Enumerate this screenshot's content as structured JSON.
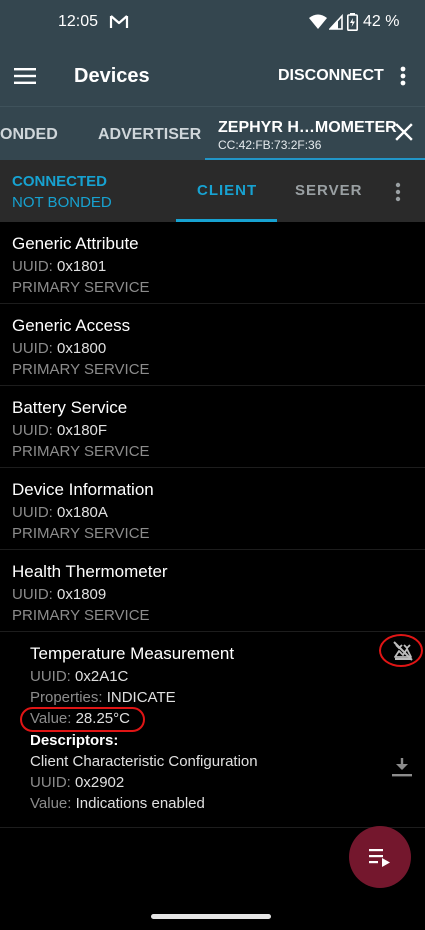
{
  "status_bar": {
    "time": "12:05",
    "battery_pct": "42 %"
  },
  "app_bar": {
    "title": "Devices",
    "disconnect_label": "DISCONNECT"
  },
  "device_tabs": {
    "bonded_label": "ONDED",
    "advertiser_label": "ADVERTISER",
    "active": {
      "name": "ZEPHYR H…MOMETER",
      "address": "CC:42:FB:73:2F:36"
    }
  },
  "connection": {
    "state": "CONNECTED",
    "bond": "NOT BONDED",
    "tabs": {
      "client": "CLIENT",
      "server": "SERVER"
    }
  },
  "labels": {
    "uuid": "UUID:",
    "properties": "Properties:",
    "value": "Value:",
    "descriptors": "Descriptors:"
  },
  "services": [
    {
      "name": "Generic Attribute",
      "uuid": "0x1801",
      "type": "PRIMARY SERVICE"
    },
    {
      "name": "Generic Access",
      "uuid": "0x1800",
      "type": "PRIMARY SERVICE"
    },
    {
      "name": "Battery Service",
      "uuid": "0x180F",
      "type": "PRIMARY SERVICE"
    },
    {
      "name": "Device Information",
      "uuid": "0x180A",
      "type": "PRIMARY SERVICE"
    },
    {
      "name": "Health Thermometer",
      "uuid": "0x1809",
      "type": "PRIMARY SERVICE"
    }
  ],
  "characteristic": {
    "name": "Temperature Measurement",
    "uuid": "0x2A1C",
    "properties": "INDICATE",
    "value": "28.25°C",
    "descriptor": {
      "name": "Client Characteristic Configuration",
      "uuid": "0x2902",
      "value": "Indications enabled"
    }
  },
  "colors": {
    "accent": "#17a2d1",
    "appbar": "#34464f",
    "fab": "#74172d",
    "annotation": "#e01515"
  }
}
